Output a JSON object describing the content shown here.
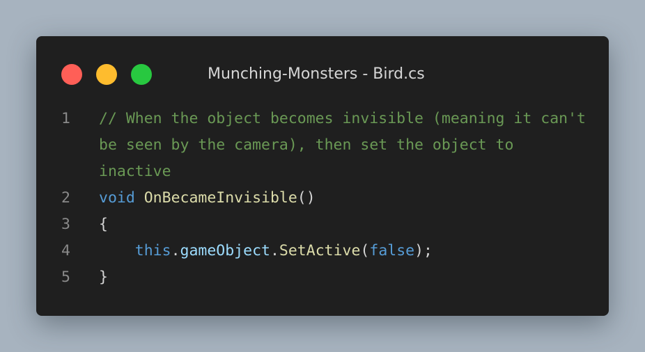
{
  "window": {
    "title": "Munching-Monsters - Bird.cs",
    "traffic_lights": [
      {
        "name": "close",
        "color": "#ff5f57"
      },
      {
        "name": "minimize",
        "color": "#febc2e"
      },
      {
        "name": "maximize",
        "color": "#28c840"
      }
    ]
  },
  "colors": {
    "background": "#a7b3bf",
    "editor_bg": "#1f1f1f",
    "comment": "#6a9955",
    "keyword": "#569cd6",
    "function": "#dcdcaa",
    "property": "#9cdcfe",
    "punctuation": "#d4d4d4",
    "line_number": "#8a8a8a"
  },
  "code": {
    "lines": [
      {
        "number": "1",
        "tokens": [
          {
            "text": "// When the object becomes invisible (meaning it can't be seen by the camera), then set the object to inactive",
            "type": "comment"
          }
        ]
      },
      {
        "number": "2",
        "tokens": [
          {
            "text": "void",
            "type": "keyword"
          },
          {
            "text": " ",
            "type": "punctuation"
          },
          {
            "text": "OnBecameInvisible",
            "type": "function"
          },
          {
            "text": "()",
            "type": "punctuation"
          }
        ]
      },
      {
        "number": "3",
        "tokens": [
          {
            "text": "{",
            "type": "punctuation"
          }
        ]
      },
      {
        "number": "4",
        "tokens": [
          {
            "text": "    ",
            "type": "punctuation"
          },
          {
            "text": "this",
            "type": "keyword"
          },
          {
            "text": ".",
            "type": "punctuation"
          },
          {
            "text": "gameObject",
            "type": "property"
          },
          {
            "text": ".",
            "type": "punctuation"
          },
          {
            "text": "SetActive",
            "type": "function"
          },
          {
            "text": "(",
            "type": "punctuation"
          },
          {
            "text": "false",
            "type": "keyword"
          },
          {
            "text": ");",
            "type": "punctuation"
          }
        ]
      },
      {
        "number": "5",
        "tokens": [
          {
            "text": "}",
            "type": "punctuation"
          }
        ]
      }
    ]
  }
}
